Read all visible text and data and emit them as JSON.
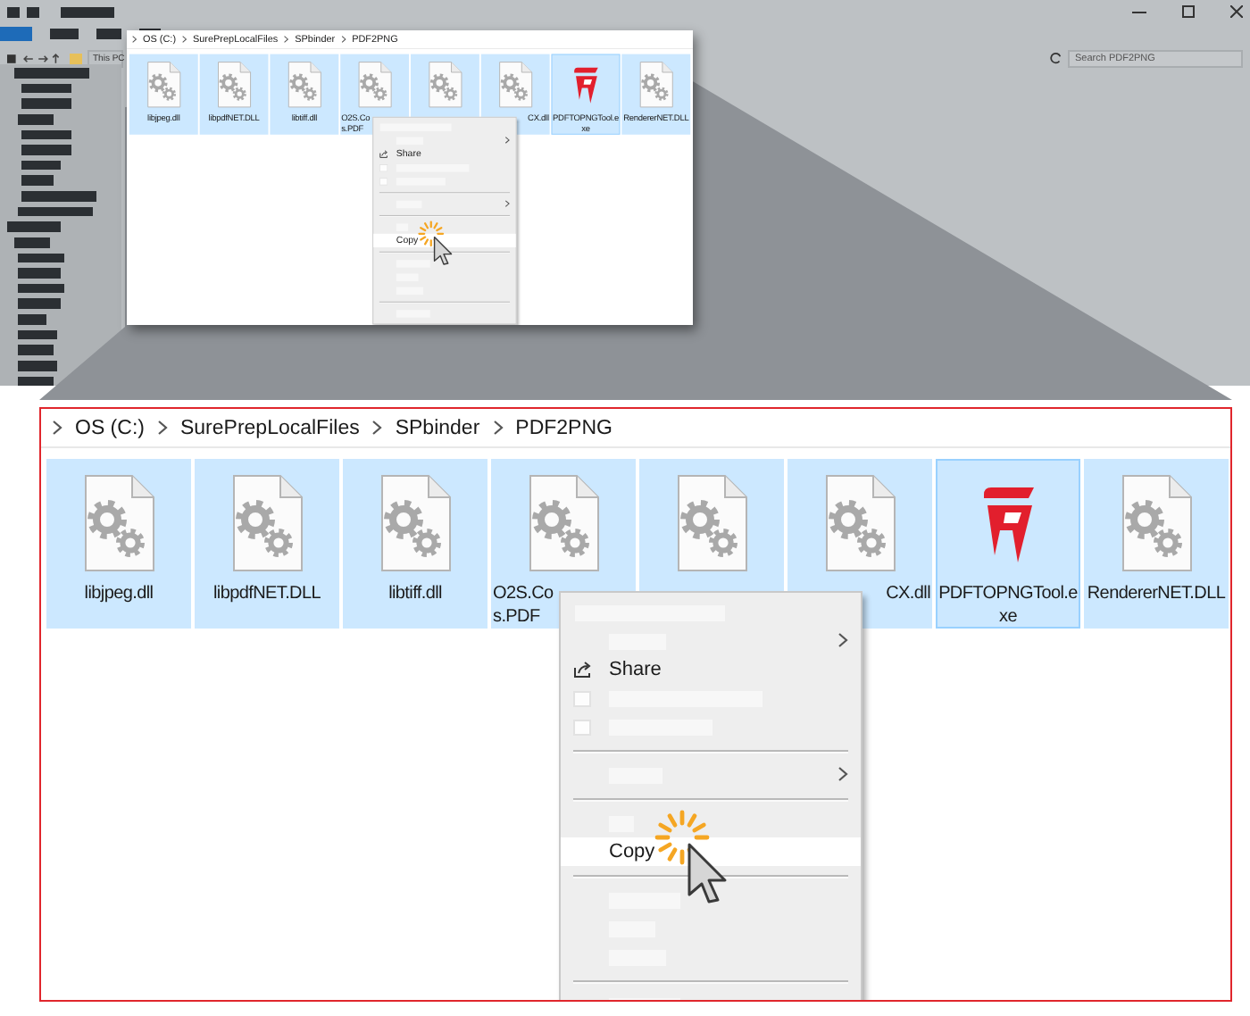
{
  "backdrop": {
    "address": "This PC",
    "search": {
      "placeholder": "Search PDF2PNG"
    }
  },
  "inset": {
    "breadcrumb": [
      "OS (C:)",
      "SurePrepLocalFiles",
      "SPbinder",
      "PDF2PNG"
    ],
    "files": [
      {
        "lines": [
          "libjpeg.dll"
        ],
        "kind": "gear-file",
        "selected": true,
        "focused": false,
        "covered_left": false,
        "covered_right": false
      },
      {
        "lines": [
          "libpdfNET.DLL"
        ],
        "kind": "gear-file",
        "selected": true,
        "focused": false,
        "covered_left": false,
        "covered_right": false
      },
      {
        "lines": [
          "libtiff.dll"
        ],
        "kind": "gear-file",
        "selected": true,
        "focused": false,
        "covered_left": false,
        "covered_right": false
      },
      {
        "lines": [
          "O2S.Co",
          "s.PDF"
        ],
        "kind": "gear-file",
        "selected": true,
        "focused": false,
        "covered_left": false,
        "covered_right": true
      },
      {
        "kind": "gear-file",
        "selected": true,
        "focused": false
      },
      {
        "lines": [
          "CX.dll"
        ],
        "kind": "gear-file",
        "selected": true,
        "focused": false,
        "covered_left": true,
        "covered_right": false
      },
      {
        "lines": [
          "PDFTOPNGTool.e",
          "xe"
        ],
        "kind": "app",
        "selected": true,
        "focused": true,
        "covered_left": false,
        "covered_right": false
      },
      {
        "lines": [
          "RendererNET.DLL"
        ],
        "kind": "gear-file",
        "selected": true,
        "focused": false,
        "covered_left": false,
        "covered_right": false
      }
    ],
    "menu": [
      {
        "kind": "placeholder",
        "submenu": false,
        "selected": false
      },
      {
        "kind": "placeholder",
        "submenu": true,
        "selected": false
      },
      {
        "kind": "share_item",
        "label": "Share",
        "selected": false
      },
      {
        "kind": "icon_placeholder",
        "submenu": false,
        "selected": false
      },
      {
        "kind": "icon_placeholder",
        "submenu": false,
        "selected": false
      },
      {
        "kind": "separator"
      },
      {
        "kind": "placeholder",
        "submenu": true,
        "selected": false
      },
      {
        "kind": "separator"
      },
      {
        "kind": "placeholder",
        "submenu": false,
        "selected": false
      },
      {
        "kind": "item",
        "label": "Copy",
        "selected": true
      },
      {
        "kind": "separator"
      },
      {
        "kind": "placeholder",
        "submenu": false,
        "selected": false
      },
      {
        "kind": "placeholder",
        "submenu": false,
        "selected": false
      },
      {
        "kind": "placeholder",
        "submenu": false,
        "selected": false
      },
      {
        "kind": "separator"
      },
      {
        "kind": "placeholder",
        "submenu": false,
        "selected": false
      }
    ]
  },
  "zoom": {
    "breadcrumb": [
      "OS (C:)",
      "SurePrepLocalFiles",
      "SPbinder",
      "PDF2PNG"
    ],
    "files": [
      {
        "lines": [
          "libjpeg.dll"
        ],
        "kind": "gear-file",
        "selected": true,
        "focused": false,
        "covered_left": false,
        "covered_right": false
      },
      {
        "lines": [
          "libpdfNET.DLL"
        ],
        "kind": "gear-file",
        "selected": true,
        "focused": false,
        "covered_left": false,
        "covered_right": false
      },
      {
        "lines": [
          "libtiff.dll"
        ],
        "kind": "gear-file",
        "selected": true,
        "focused": false,
        "covered_left": false,
        "covered_right": false
      },
      {
        "lines": [
          "O2S.Co",
          "s.PDF"
        ],
        "kind": "gear-file",
        "selected": true,
        "focused": false,
        "covered_left": false,
        "covered_right": true
      },
      {
        "kind": "gear-file",
        "selected": true,
        "focused": false
      },
      {
        "lines": [
          "CX.dll"
        ],
        "kind": "gear-file",
        "selected": true,
        "focused": false,
        "covered_left": true,
        "covered_right": false
      },
      {
        "lines": [
          "PDFTOPNGTool.e",
          "xe"
        ],
        "kind": "app",
        "selected": true,
        "focused": true,
        "covered_left": false,
        "covered_right": false
      },
      {
        "lines": [
          "RendererNET.DLL"
        ],
        "kind": "gear-file",
        "selected": true,
        "focused": false,
        "covered_left": false,
        "covered_right": false
      }
    ],
    "menu": [
      {
        "kind": "placeholder",
        "submenu": false,
        "selected": false
      },
      {
        "kind": "placeholder",
        "submenu": true,
        "selected": false
      },
      {
        "kind": "share_item",
        "label": "Share",
        "selected": false
      },
      {
        "kind": "icon_placeholder",
        "submenu": false,
        "selected": false
      },
      {
        "kind": "icon_placeholder",
        "submenu": false,
        "selected": false
      },
      {
        "kind": "separator"
      },
      {
        "kind": "placeholder",
        "submenu": true,
        "selected": false
      },
      {
        "kind": "separator"
      },
      {
        "kind": "placeholder",
        "submenu": false,
        "selected": false
      },
      {
        "kind": "item",
        "label": "Copy",
        "selected": true
      },
      {
        "kind": "separator"
      },
      {
        "kind": "placeholder",
        "submenu": false,
        "selected": false
      },
      {
        "kind": "placeholder",
        "submenu": false,
        "selected": false
      },
      {
        "kind": "placeholder",
        "submenu": false,
        "selected": false
      },
      {
        "kind": "separator"
      },
      {
        "kind": "placeholder",
        "submenu": false,
        "selected": false
      }
    ]
  }
}
